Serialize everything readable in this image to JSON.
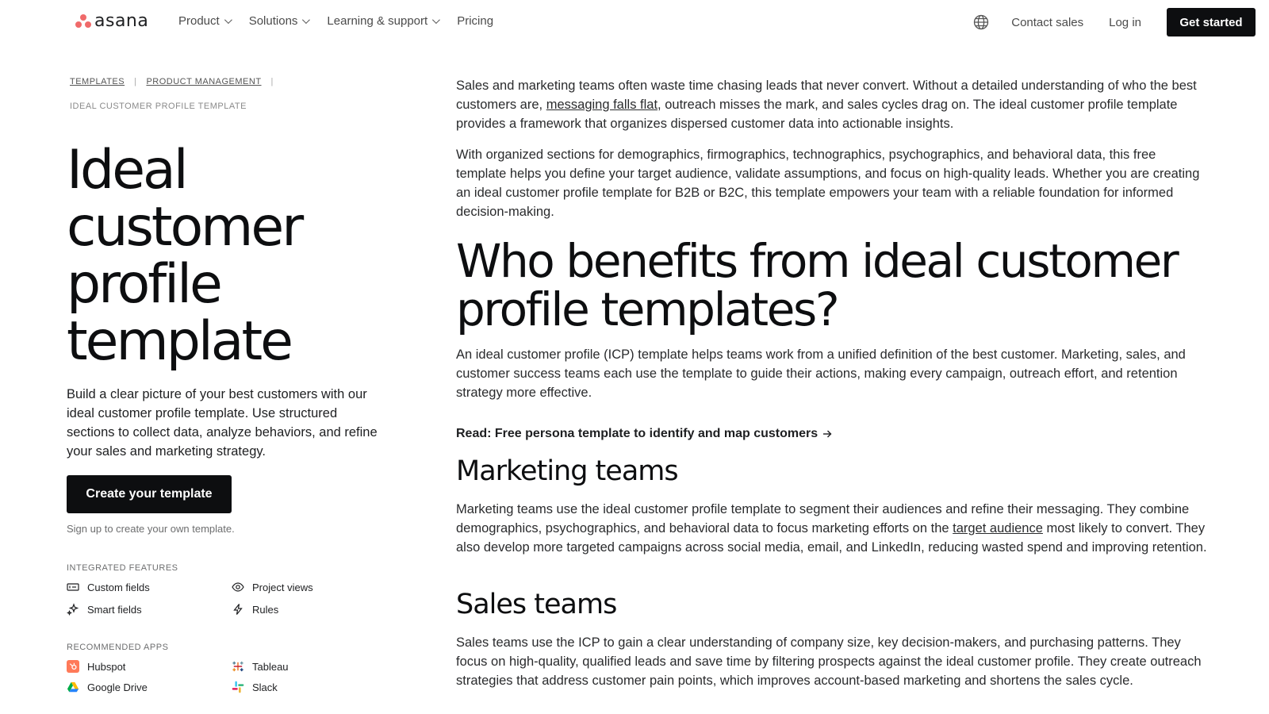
{
  "nav": {
    "logo_text": "asana",
    "links": [
      {
        "label": "Product"
      },
      {
        "label": "Solutions"
      },
      {
        "label": "Learning & support"
      },
      {
        "label": "Pricing"
      }
    ],
    "contact_sales": "Contact sales",
    "log_in": "Log in",
    "get_started": "Get started"
  },
  "breadcrumbs": {
    "items": [
      "TEMPLATES",
      "PRODUCT MANAGEMENT"
    ],
    "current": "IDEAL CUSTOMER PROFILE TEMPLATE"
  },
  "hero": {
    "title_lines": [
      "Ideal",
      "customer",
      "profile",
      "template"
    ],
    "description": "Build a clear picture of your best customers with our ideal customer profile template. Use structured sections to collect data, analyze behaviors, and refine your sales and marketing strategy.",
    "cta": "Create your template",
    "signup_note": "Sign up to create your own template."
  },
  "integrated_features": {
    "label": "INTEGRATED FEATURES",
    "items": [
      "Custom fields",
      "Project views",
      "Smart fields",
      "Rules"
    ]
  },
  "recommended_apps": {
    "label": "RECOMMENDED APPS",
    "items": [
      "Hubspot",
      "Tableau",
      "Google Drive",
      "Slack"
    ]
  },
  "content": {
    "intro_p1_before": "Sales and marketing teams often waste time chasing leads that never convert. Without a detailed understanding of who the best customers are, ",
    "intro_p1_link": "messaging falls flat",
    "intro_p1_after": ", outreach misses the mark, and sales cycles drag on. The ideal customer profile template provides a framework that organizes dispersed customer data into actionable insights.",
    "intro_p2": "With organized sections for demographics, firmographics, technographics, psychographics, and behavioral data, this free template helps you define your target audience, validate assumptions, and focus on high-quality leads. Whether you are creating an ideal customer profile template for B2B or B2C, this template empowers your team with a reliable foundation for informed decision-making.",
    "who_heading": "Who benefits from ideal customer profile templates?",
    "who_p": "An ideal customer profile (ICP) template helps teams work from a unified definition of the best customer. Marketing, sales, and customer success teams each use the template to guide their actions, making every campaign, outreach effort, and retention strategy more effective.",
    "read_link": "Read: Free persona template to identify and map customers",
    "marketing_heading": "Marketing teams",
    "marketing_p_before": "Marketing teams use the ideal customer profile template to segment their audiences and refine their messaging. They combine demographics, psychographics, and behavioral data to focus marketing efforts on the ",
    "marketing_p_link": "target audience",
    "marketing_p_after": " most likely to convert. They also develop more targeted campaigns across social media, email, and LinkedIn, reducing wasted spend and improving retention.",
    "sales_heading": "Sales teams",
    "sales_p": "Sales teams use the ICP to gain a clear understanding of company size, key decision-makers, and purchasing patterns. They focus on high-quality, qualified leads and save time by filtering prospects against the ideal customer profile. They create outreach strategies that address customer pain points, which improves account-based marketing and shortens the sales cycle."
  },
  "colors": {
    "brand_coral": "#f06a6a",
    "button_dark": "#0d0e10",
    "text": "#1e1f21"
  }
}
